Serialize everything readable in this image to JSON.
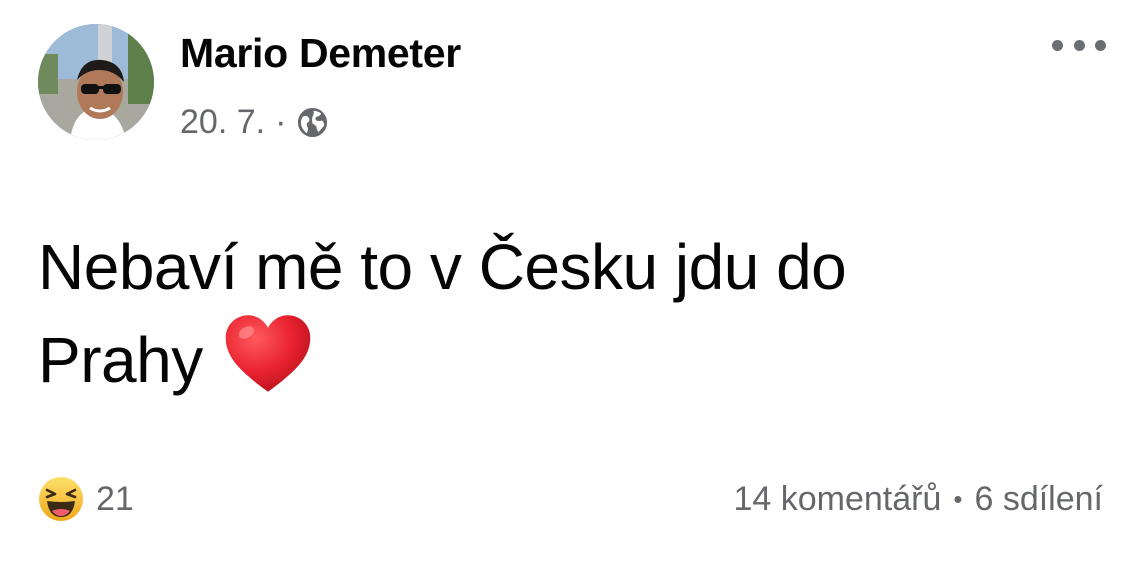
{
  "post": {
    "author": "Mario Demeter",
    "date": "20. 7.",
    "separator": "·",
    "audience_icon": "globe-icon",
    "more_icon": "more-options-icon",
    "message_line1": "Nebaví mě to v Česku jdu do",
    "message_line2": "Prahy",
    "message_emoji": "red-heart-emoji"
  },
  "footer": {
    "reaction_icon": "haha-reaction-icon",
    "reaction_count": "21",
    "comments": "14 komentářů",
    "dot": "•",
    "shares": "6 sdílení"
  },
  "colors": {
    "primary_text": "#050505",
    "secondary_text": "#65676b",
    "heart": "#e8212e",
    "haha_face": "#f7c531"
  }
}
